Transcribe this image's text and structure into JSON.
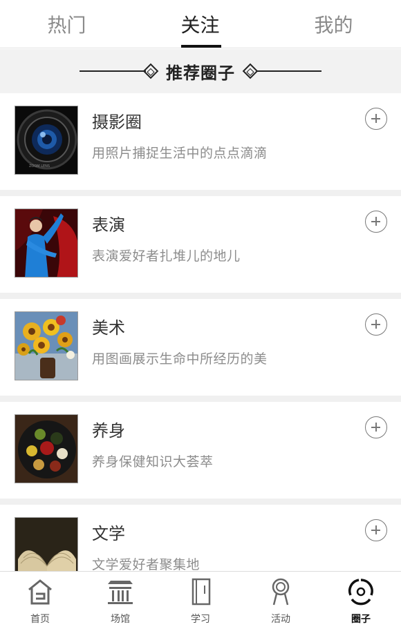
{
  "tabs": [
    {
      "label": "热门",
      "active": false
    },
    {
      "label": "关注",
      "active": true
    },
    {
      "label": "我的",
      "active": false
    }
  ],
  "section": {
    "title": "推荐圈子"
  },
  "circles": [
    {
      "name": "摄影圈",
      "desc": "用照片捕捉生活中的点点滴滴",
      "image": "camera-lens-photo"
    },
    {
      "name": "表演",
      "desc": "表演爱好者扎堆儿的地儿",
      "image": "performer-photo"
    },
    {
      "name": "美术",
      "desc": "用图画展示生命中所经历的美",
      "image": "sunflower-painting"
    },
    {
      "name": "养身",
      "desc": "养身保健知识大荟萃",
      "image": "grains-plate-photo"
    },
    {
      "name": "文学",
      "desc": "文学爱好者聚集地",
      "image": "open-book-photo"
    }
  ],
  "bottom_nav": [
    {
      "label": "首页",
      "icon": "home-icon",
      "active": false
    },
    {
      "label": "场馆",
      "icon": "venue-icon",
      "active": false
    },
    {
      "label": "学习",
      "icon": "book-icon",
      "active": false
    },
    {
      "label": "活动",
      "icon": "activity-icon",
      "active": false
    },
    {
      "label": "圈子",
      "icon": "circle-icon",
      "active": true
    }
  ],
  "colors": {
    "accent": "#111111",
    "muted": "#8c8c8c",
    "divider": "#f0f0f0"
  }
}
